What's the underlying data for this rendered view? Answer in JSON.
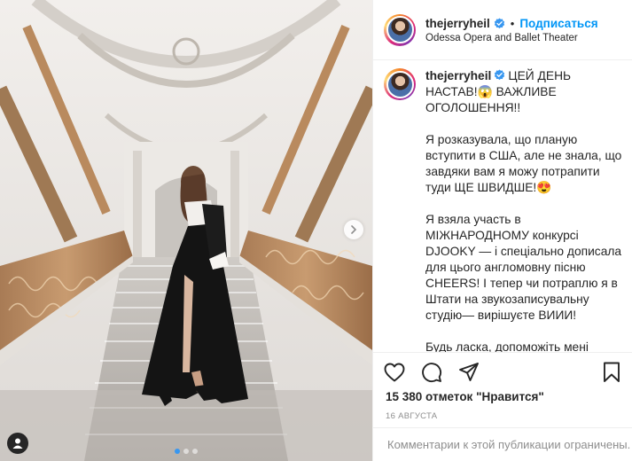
{
  "post": {
    "username": "thejerryheil",
    "follow_label": "Подписаться",
    "separator": "•",
    "location": "Odessa Opera and Ballet Theater",
    "verified_icon": "verified-badge-icon",
    "caption": {
      "line1": "ЦЕЙ ДЕНЬ НАСТАВ!😱 ВАЖЛИВЕ ОГОЛОШЕННЯ!!",
      "p2": "Я розказувала, що планую вступити в США, але не знала, що завдяки вам я можу потрапити туди ЩЕ ШВИДШЕ!😍",
      "p3": "Я взяла участь в МІЖНАРОДНОМУ конкурсі DJOOKY — і спеціально дописала для цього англомовну пісню CHEERS! І тепер чи потраплю я в Штати на звукозаписувальну студію— вирішуєте ВИИИ!",
      "p4": "Будь ласка, допоможіть мені здійснити мрію — я вірю в силу нашої армії! Проголосуйте за мою пісню на сайті DJOOKY (я лишаю активний свайп в сторіз!)"
    },
    "likes": "15 380 отметок \"Нравится\"",
    "date": "16 АВГУСТА",
    "comments_notice": "Комментарии к этой публикации ограничены.",
    "carousel": {
      "count": 3,
      "active_index": 0
    },
    "colors": {
      "accent": "#0095f6",
      "text": "#262626",
      "muted": "#8e8e8e",
      "dot_active": "#3897f0"
    }
  }
}
